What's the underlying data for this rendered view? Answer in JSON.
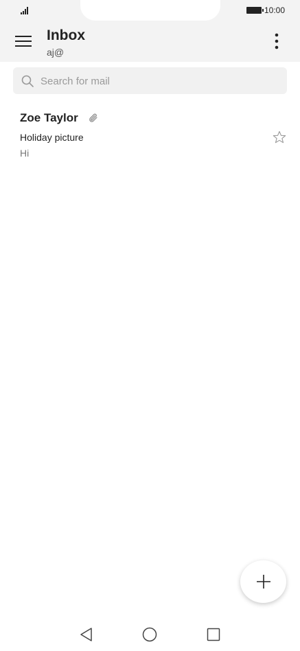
{
  "status_bar": {
    "time": "10:00",
    "signal_icon": "signal-icon",
    "battery_icon": "battery-icon"
  },
  "header": {
    "title": "Inbox",
    "account": "aj@",
    "menu_icon": "menu-icon",
    "more_icon": "more-vert-icon"
  },
  "search": {
    "placeholder": "Search for mail",
    "value": "",
    "icon": "search-icon"
  },
  "mails": [
    {
      "sender": "Zoe Taylor",
      "subject": "Holiday picture",
      "preview": "Hi",
      "has_attachment": true,
      "starred": false
    }
  ],
  "fab": {
    "icon": "plus-icon"
  },
  "nav": {
    "back_icon": "back-triangle-icon",
    "home_icon": "home-circle-icon",
    "recents_icon": "recents-square-icon"
  },
  "colors": {
    "bar_bg": "#f3f3f3",
    "search_bg": "#f1f1f1",
    "text": "#222222",
    "muted": "#777777"
  }
}
